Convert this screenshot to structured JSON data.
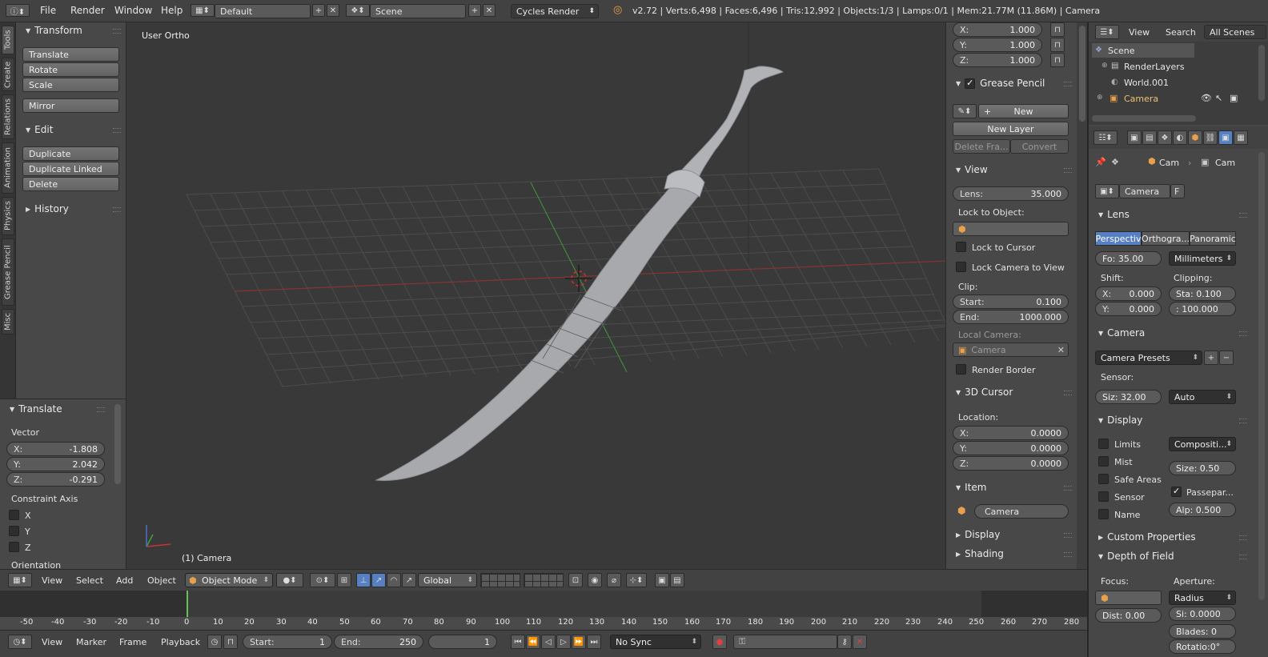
{
  "topbar": {
    "menus": [
      "File",
      "Render",
      "Window",
      "Help"
    ],
    "layout": "Default",
    "scene": "Scene",
    "engine": "Cycles Render",
    "stats": "v2.72 | Verts:6,498 | Faces:6,496 | Tris:12,992 | Objects:1/3 | Lamps:0/1 | Mem:21.77M (11.86M) | Camera"
  },
  "tool_tabs": [
    "Tools",
    "Create",
    "Relations",
    "Animation",
    "Physics",
    "Grease Pencil",
    "Misc"
  ],
  "tools": {
    "transform_header": "Transform",
    "transform_buttons": [
      "Translate",
      "Rotate",
      "Scale"
    ],
    "mirror": "Mirror",
    "edit_header": "Edit",
    "edit_buttons": [
      "Duplicate",
      "Duplicate Linked",
      "Delete"
    ],
    "history_header": "History"
  },
  "operator": {
    "header": "Translate",
    "vector_label": "Vector",
    "x": {
      "k": "X:",
      "v": "-1.808"
    },
    "y": {
      "k": "Y:",
      "v": "2.042"
    },
    "z": {
      "k": "Z:",
      "v": "-0.291"
    },
    "constraint_label": "Constraint Axis",
    "axes": [
      "X",
      "Y",
      "Z"
    ],
    "orientation": "Orientation"
  },
  "viewport": {
    "view_name": "User Ortho",
    "object_label": "(1) Camera"
  },
  "npanel": {
    "scale": [
      {
        "k": "X:",
        "v": "1.000"
      },
      {
        "k": "Y:",
        "v": "1.000"
      },
      {
        "k": "Z:",
        "v": "1.000"
      }
    ],
    "grease_header": "Grease Pencil",
    "new": "New",
    "new_layer": "New Layer",
    "delete_frame": "Delete Fra...",
    "convert": "Convert",
    "view_header": "View",
    "lens": {
      "k": "Lens:",
      "v": "35.000"
    },
    "lock_to_object": "Lock to Object:",
    "lock_cursor": "Lock to Cursor",
    "lock_camera": "Lock Camera to View",
    "clip": "Clip:",
    "clip_start": {
      "k": "Start:",
      "v": "0.100"
    },
    "clip_end": {
      "k": "End:",
      "v": "1000.000"
    },
    "local_camera": "Local Camera:",
    "local_camera_value": "Camera",
    "render_border": "Render Border",
    "cursor_header": "3D Cursor",
    "location": "Location:",
    "cx": {
      "k": "X:",
      "v": "0.0000"
    },
    "cy": {
      "k": "Y:",
      "v": "0.0000"
    },
    "cz": {
      "k": "Z:",
      "v": "0.0000"
    },
    "item_header": "Item",
    "item_name": "Camera",
    "display_header": "Display",
    "shading_header": "Shading"
  },
  "outliner": {
    "menus": [
      "View",
      "Search"
    ],
    "filter": "All Scenes",
    "items": [
      "Scene",
      "RenderLayers",
      "World.001",
      "Camera"
    ]
  },
  "props": {
    "crumbs": [
      "Cam",
      "Cam"
    ],
    "datablock": "Camera",
    "fake": "F",
    "lens_header": "Lens",
    "lens_types": [
      "Perspectiv",
      "Orthogra...",
      "Panoramic"
    ],
    "focal": "Fo: 35.00",
    "units": "Millimeters",
    "shift": "Shift:",
    "clipping": "Clipping:",
    "shift_x": {
      "k": "X:",
      "v": "0.000"
    },
    "shift_y": {
      "k": "Y:",
      "v": "0.000"
    },
    "clip_sta": "Sta: 0.100",
    "clip_end": ": 100.000",
    "camera_header": "Camera",
    "presets": "Camera Presets",
    "sensor": "Sensor:",
    "sensor_size": "Siz: 32.00",
    "sensor_fit": "Auto",
    "display_header": "Display",
    "display_checks": [
      "Limits",
      "Mist",
      "Safe Areas",
      "Sensor",
      "Name"
    ],
    "composition": "Compositi...",
    "display_size": "Size: 0.50",
    "passepartout": "Passepar...",
    "alpha": "Alp: 0.500",
    "custom_props": "Custom Properties",
    "dof_header": "Depth of Field",
    "focus": "Focus:",
    "aperture": "Aperture:",
    "aperture_type": "Radius",
    "dist": "Dist: 0.00",
    "size": "Si: 0.0000",
    "blades": "Blades: 0",
    "rotation": "Rotatio:0°"
  },
  "vheader": {
    "menus": [
      "View",
      "Select",
      "Add",
      "Object"
    ],
    "mode": "Object Mode",
    "orientation": "Global"
  },
  "timeline": {
    "ticks": [
      "-50",
      "-40",
      "-30",
      "-20",
      "-10",
      "0",
      "10",
      "20",
      "30",
      "40",
      "50",
      "60",
      "70",
      "80",
      "90",
      "100",
      "110",
      "120",
      "130",
      "140",
      "150",
      "160",
      "170",
      "180",
      "190",
      "200",
      "210",
      "220",
      "230",
      "240",
      "250",
      "260",
      "270",
      "280"
    ],
    "current_frame_value": 0
  },
  "tlhead": {
    "menus": [
      "View",
      "Marker",
      "Frame",
      "Playback"
    ],
    "start": {
      "k": "Start:",
      "v": "1"
    },
    "end": {
      "k": "End:",
      "v": "250"
    },
    "current": "1",
    "sync": "No Sync"
  }
}
